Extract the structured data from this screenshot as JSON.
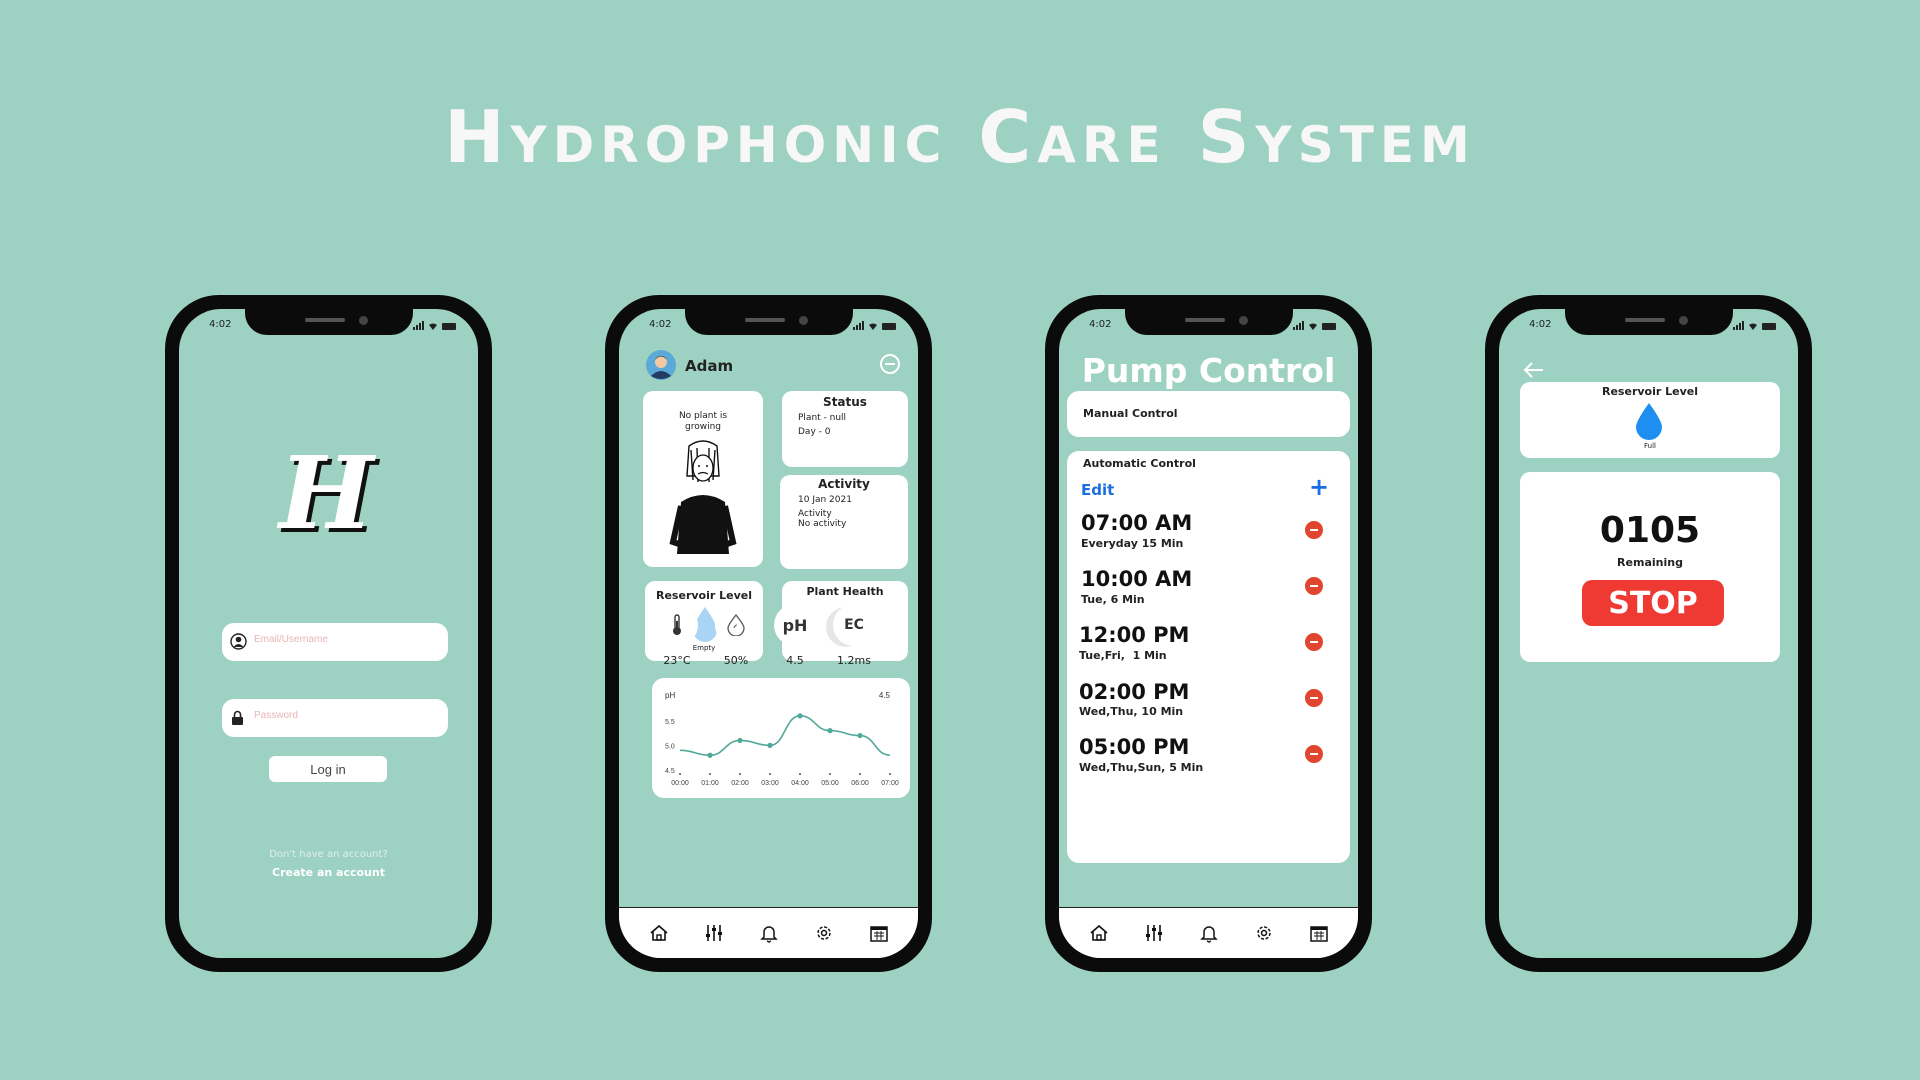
{
  "page_title": "Hydrophonic Care System",
  "status_time": "4:02",
  "login": {
    "logo_letter": "H",
    "email_placeholder": "Email/Username",
    "password_placeholder": "Password",
    "login_label": "Log in",
    "no_account_text": "Don't have an account?",
    "create_account_label": "Create an account"
  },
  "dashboard": {
    "user_name": "Adam",
    "plant_card_text": "No plant is growing",
    "status": {
      "title": "Status",
      "plant": "Plant - null",
      "day": "Day - 0"
    },
    "activity": {
      "title": "Activity",
      "date": "10 Jan 2021",
      "label": "Activity",
      "value": "No activity"
    },
    "reservoir": {
      "title": "Reservoir Level",
      "state": "Empty"
    },
    "plant_health": {
      "title": "Plant Health",
      "value": "-"
    },
    "sensors": [
      {
        "icon": "thermometer-icon",
        "glyph": "",
        "value": "23°C"
      },
      {
        "icon": "humidity-drop-icon",
        "glyph": "",
        "value": "50%"
      },
      {
        "icon": "ph-icon",
        "glyph": "pH",
        "value": "4.5"
      },
      {
        "icon": "ec-icon",
        "glyph": "EC",
        "value": "1.2ms"
      }
    ]
  },
  "chart_data": {
    "type": "line",
    "ylabel": "pH",
    "current_value_label": "4.5",
    "x": [
      "00:00",
      "01:00",
      "02:00",
      "03:00",
      "04:00",
      "05:00",
      "06:00",
      "07:00"
    ],
    "y": [
      4.9,
      4.8,
      5.1,
      5.0,
      5.6,
      5.3,
      5.2,
      4.8
    ],
    "yticks": [
      "5.5",
      "5.0",
      "4.5"
    ],
    "ylim": [
      4.5,
      5.8
    ],
    "color": "#4fa99a",
    "grid": false
  },
  "pump": {
    "title": "Pump Control",
    "manual_label": "Manual Control",
    "automatic_label": "Automatic Control",
    "edit_label": "Edit",
    "add_symbol": "+",
    "schedules": [
      {
        "time": "07:00 AM",
        "desc": "Everyday 15 Min"
      },
      {
        "time": "10:00 AM",
        "desc": "Tue, 6 Min"
      },
      {
        "time": "12:00 PM",
        "desc": "Tue,Fri,  1 Min"
      },
      {
        "time": "02:00 PM",
        "desc": "Wed,Thu, 10 Min"
      },
      {
        "time": "05:00 PM",
        "desc": "Wed,Thu,Sun, 5 Min"
      }
    ]
  },
  "timer": {
    "reservoir_title": "Reservoir Level",
    "reservoir_state": "Full",
    "countdown": "0105",
    "remaining_label": "Remaining",
    "stop_label": "STOP"
  },
  "colors": {
    "background": "#9dd2c3",
    "accent_blue": "#1a6fe0",
    "drop_blue": "#1e8ff0",
    "drop_light": "#a9d4f3",
    "stop_red": "#ee3a33",
    "remove_red": "#e2452f"
  },
  "nav_icons": [
    "home-icon",
    "sliders-icon",
    "bell-icon",
    "gear-icon",
    "calendar-icon"
  ]
}
